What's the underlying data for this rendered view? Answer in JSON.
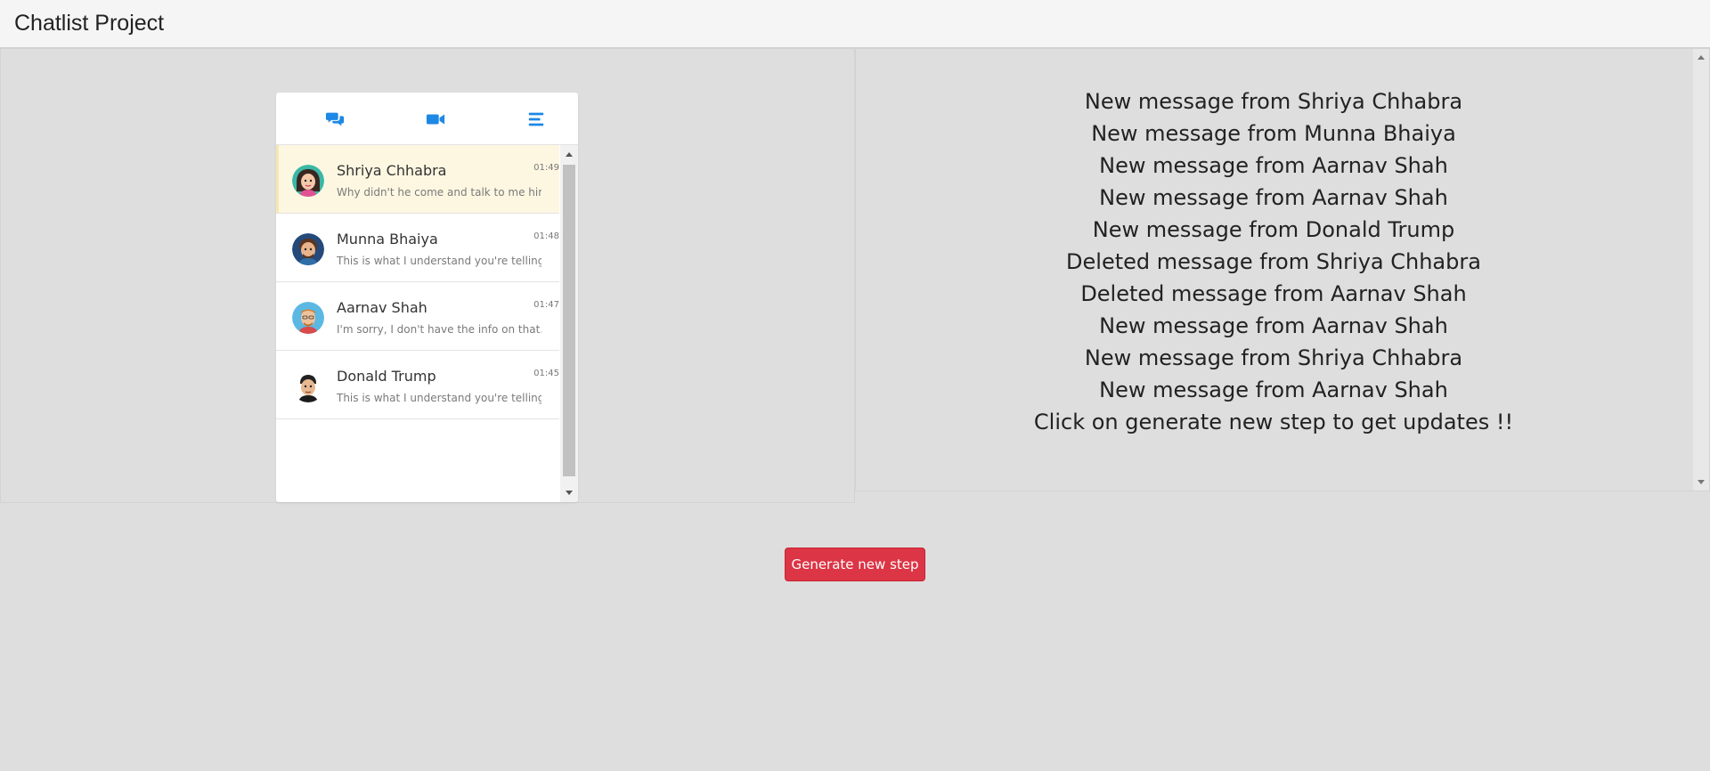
{
  "app": {
    "title": "Chatlist Project"
  },
  "tabs": [
    {
      "icon": "chat-bubbles-icon"
    },
    {
      "icon": "video-camera-icon"
    },
    {
      "icon": "menu-icon"
    }
  ],
  "chats": [
    {
      "name": "Shriya Chhabra",
      "preview": "Why didn't he come and talk to me himse...",
      "time": "01:49",
      "active": true,
      "avatar": "female-avatar"
    },
    {
      "name": "Munna Bhaiya",
      "preview": "This is what I understand you're telling me..",
      "time": "01:48",
      "active": false,
      "avatar": "male-avatar"
    },
    {
      "name": "Aarnav Shah",
      "preview": "I'm sorry, I don't have the info on that..",
      "time": "01:47",
      "active": false,
      "avatar": "male-avatar"
    },
    {
      "name": "Donald Trump",
      "preview": "This is what I understand you're telling me..",
      "time": "01:45",
      "active": false,
      "avatar": "male-avatar"
    }
  ],
  "updates": [
    "New message from Shriya Chhabra",
    "New message from Munna Bhaiya",
    "New message from Aarnav Shah",
    "New message from Aarnav Shah",
    "New message from Donald Trump",
    "Deleted message from Shriya Chhabra",
    "Deleted message from Aarnav Shah",
    "New message from Aarnav Shah",
    "New message from Shriya Chhabra",
    "New message from Aarnav Shah",
    "Click on generate new step to get updates !!"
  ],
  "actions": {
    "generate_label": "Generate new step"
  },
  "colors": {
    "accent": "#1e88e5",
    "button": "#dc3545",
    "active_row": "#fdf7e1"
  }
}
